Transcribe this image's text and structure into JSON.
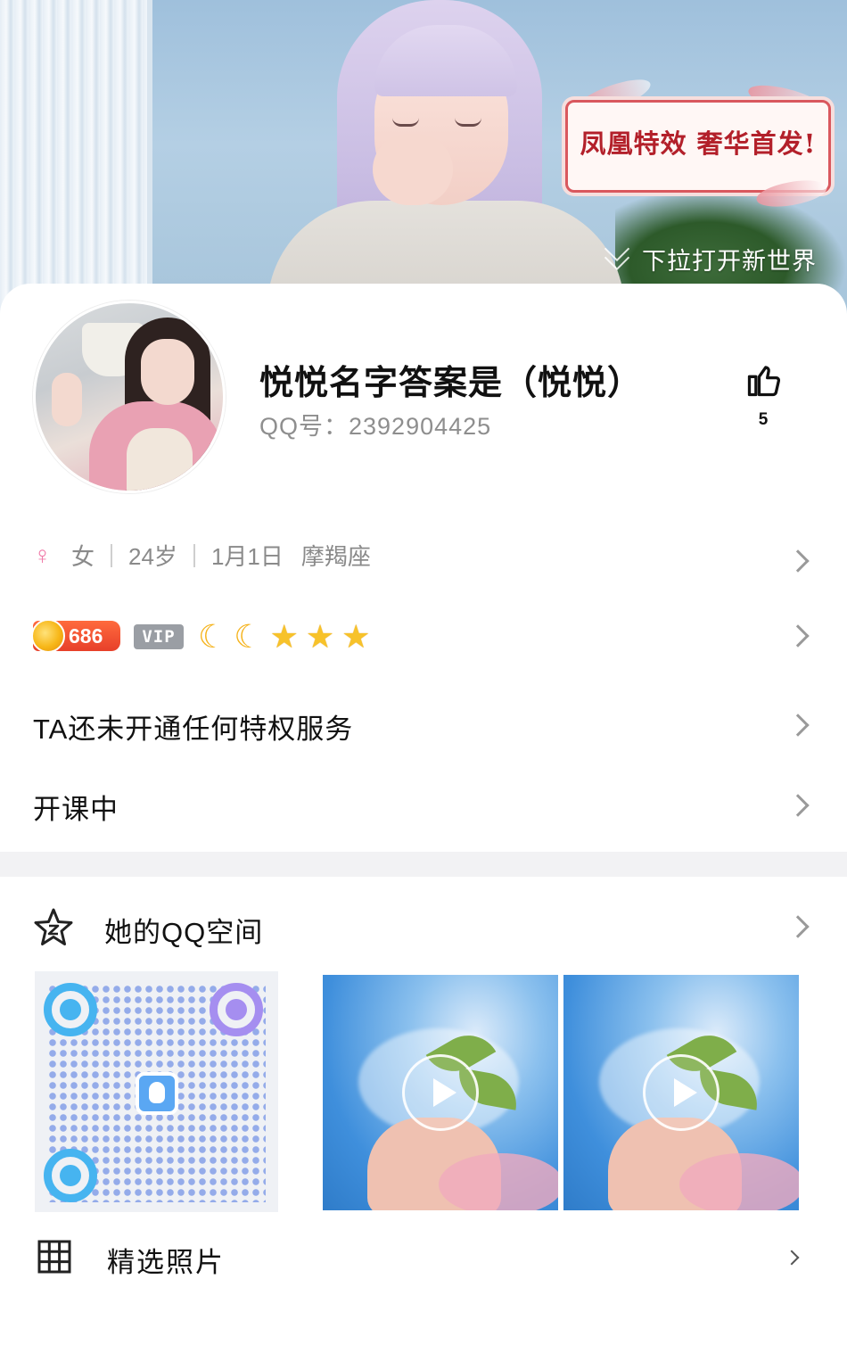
{
  "banner": {
    "promo_text": "凤凰特效 奢华首发!",
    "pulldown_hint": "下拉打开新世界"
  },
  "profile": {
    "nickname": "悦悦名字答案是（悦悦）",
    "qq_number": "QQ号：2392904425",
    "like_count": "5"
  },
  "info": {
    "gender_icon": "female-icon",
    "gender": "女",
    "age": "24岁",
    "birthday": "1月1日",
    "zodiac": "摩羯座"
  },
  "level": {
    "coin_value": "686",
    "vip_label": "VIP",
    "moon_count": 2,
    "star_count": 3,
    "colors": {
      "coin_badge": "#e7402a",
      "vip_badge": "#9a9ea4",
      "moon": "#f5b31c",
      "star": "#f7c22a"
    }
  },
  "privilege": {
    "label": "TA还未开通任何特权服务"
  },
  "course": {
    "label": "开课中"
  },
  "qzone": {
    "icon": "qzone-star-icon",
    "label": "她的QQ空间"
  },
  "photos": {
    "icon": "grid-icon",
    "label": "精选照片"
  },
  "icons": {
    "like": "thumbs-up-icon",
    "chevron": "chevron-right-icon",
    "play": "play-icon"
  }
}
